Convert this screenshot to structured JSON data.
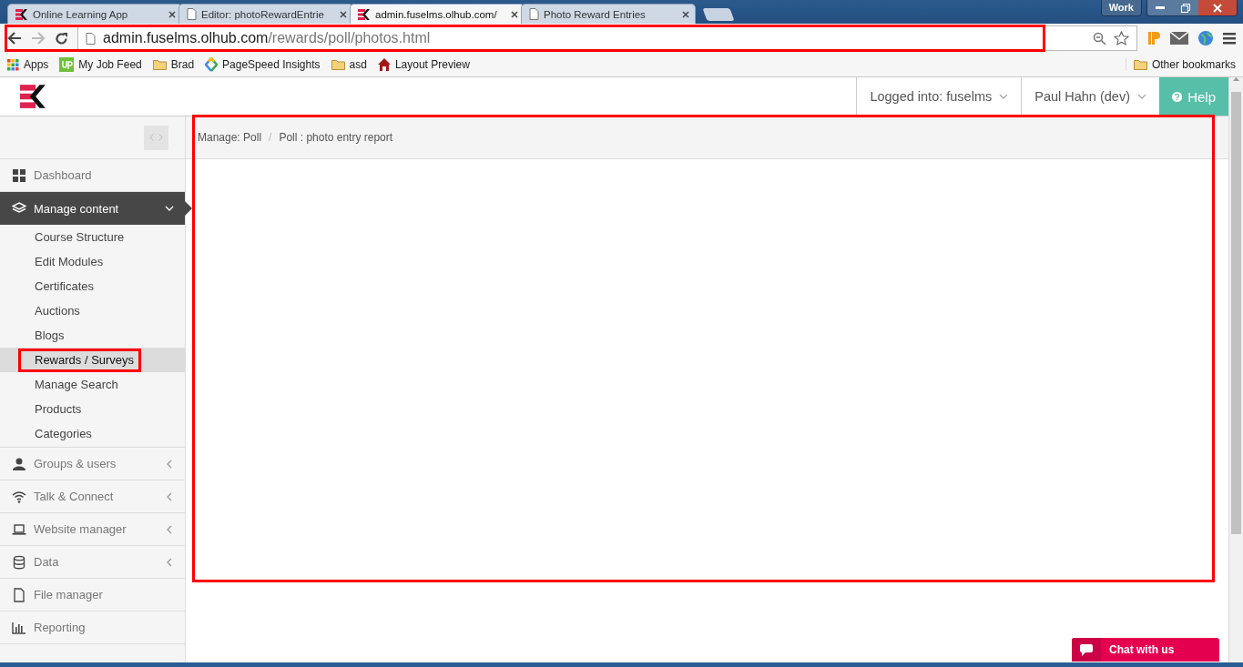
{
  "browser": {
    "tabs": [
      {
        "title": "Online Learning App",
        "selected": false
      },
      {
        "title": "Editor: photoRewardEntrie",
        "selected": false
      },
      {
        "title": "admin.fuselms.olhub.com/",
        "selected": true
      },
      {
        "title": "Photo Reward Entries",
        "selected": false
      }
    ],
    "profile": "Work",
    "address": {
      "host": "admin.fuselms.olhub.com",
      "path": "/rewards/poll/photos.html",
      "highlighted": true
    },
    "bookmarks": [
      "Apps",
      "My Job Feed",
      "Brad",
      "PageSpeed Insights",
      "asd",
      "Layout Preview"
    ],
    "other_bookmarks": "Other bookmarks"
  },
  "header": {
    "account": "Logged into: fuselms",
    "user": "Paul Hahn (dev)",
    "help": "Help"
  },
  "sidebar": {
    "items": [
      {
        "label": "Dashboard",
        "kind": "link",
        "selected": false
      },
      {
        "label": "Manage content",
        "kind": "group",
        "expanded": true,
        "selected": true,
        "children": [
          {
            "label": "Course Structure",
            "selected": false,
            "highlighted": false
          },
          {
            "label": "Edit Modules",
            "selected": false,
            "highlighted": false
          },
          {
            "label": "Certificates",
            "selected": false,
            "highlighted": false
          },
          {
            "label": "Auctions",
            "selected": false,
            "highlighted": false
          },
          {
            "label": "Blogs",
            "selected": false,
            "highlighted": false
          },
          {
            "label": "Rewards / Surveys",
            "selected": true,
            "highlighted": true
          },
          {
            "label": "Manage Search",
            "selected": false,
            "highlighted": false
          },
          {
            "label": "Products",
            "selected": false,
            "highlighted": false
          },
          {
            "label": "Categories",
            "selected": false,
            "highlighted": false
          }
        ]
      },
      {
        "label": "Groups & users",
        "kind": "group",
        "expanded": false,
        "selected": false
      },
      {
        "label": "Talk & Connect",
        "kind": "group",
        "expanded": false,
        "selected": false
      },
      {
        "label": "Website manager",
        "kind": "group",
        "expanded": false,
        "selected": false
      },
      {
        "label": "Data",
        "kind": "group",
        "expanded": false,
        "selected": false
      },
      {
        "label": "File manager",
        "kind": "link",
        "selected": false
      },
      {
        "label": "Reporting",
        "kind": "link",
        "selected": false
      }
    ]
  },
  "content": {
    "breadcrumb": [
      "Manage: Poll",
      "Poll : photo entry report"
    ],
    "separator": "/",
    "highlighted": true
  },
  "chat": {
    "label": "Chat with us"
  }
}
